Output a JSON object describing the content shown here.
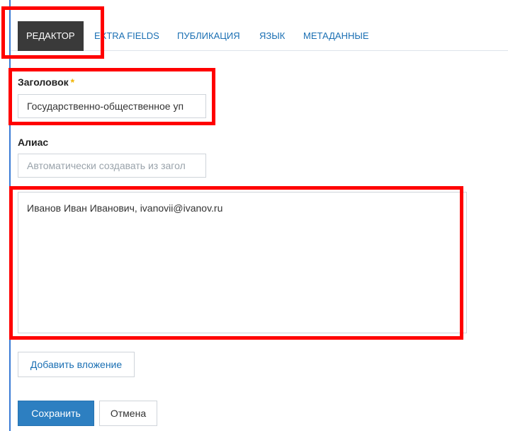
{
  "tabs": [
    {
      "label": "РЕДАКТОР",
      "active": true
    },
    {
      "label": "EXTRA FIELDS",
      "active": false
    },
    {
      "label": "ПУБЛИКАЦИЯ",
      "active": false
    },
    {
      "label": "ЯЗЫК",
      "active": false
    },
    {
      "label": "МЕТАДАННЫЕ",
      "active": false
    }
  ],
  "title_field": {
    "label": "Заголовок",
    "required_mark": "*",
    "value": "Государственно-общественное уп"
  },
  "alias_field": {
    "label": "Алиас",
    "placeholder": "Автоматически создавать из загол"
  },
  "body_text": "Иванов Иван Иванович, ivanovii@ivanov.ru",
  "buttons": {
    "attach": "Добавить вложение",
    "save": "Сохранить",
    "cancel": "Отмена"
  },
  "colors": {
    "annotation": "#ff0000",
    "tab_active_bg": "#3a3a3a",
    "link": "#1a6fb3",
    "primary_button": "#2d7fc1",
    "required_star": "#f0b400"
  }
}
